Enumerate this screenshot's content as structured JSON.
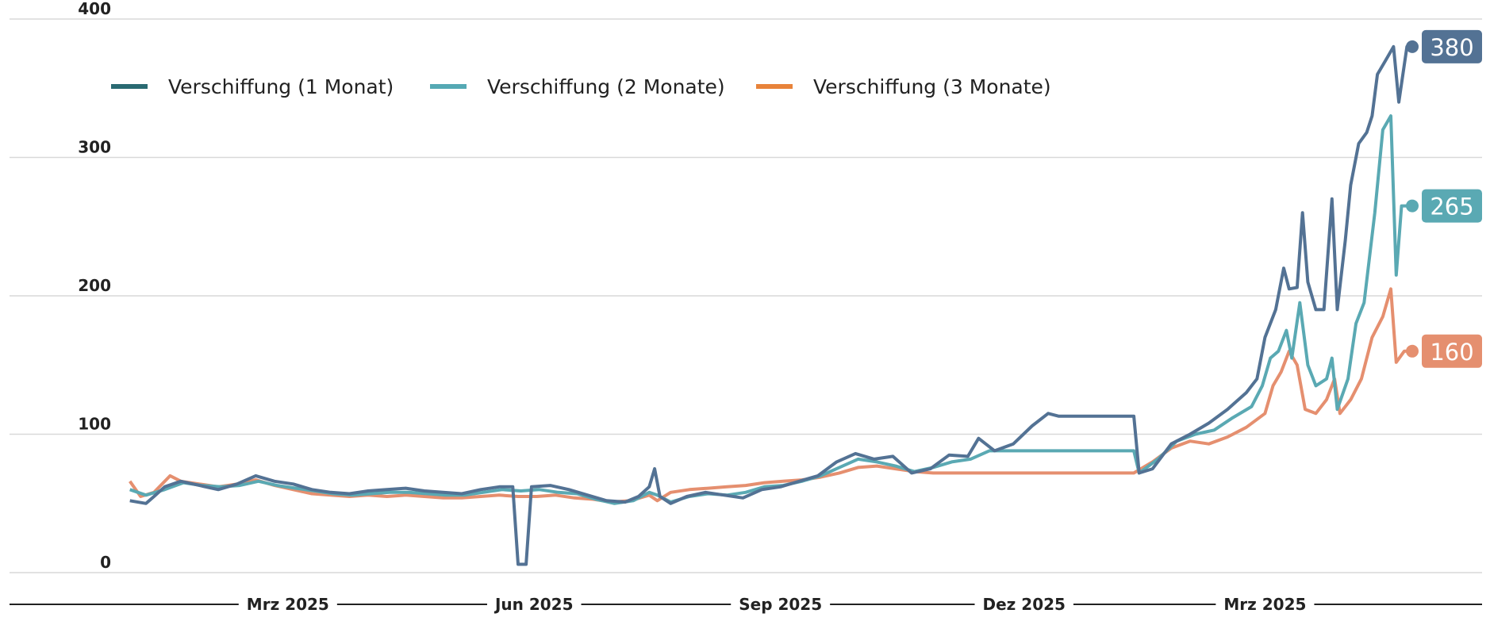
{
  "chart_data": {
    "type": "line",
    "title": "",
    "xlabel": "",
    "ylabel": "",
    "ylim": [
      0,
      400
    ],
    "yticks": [
      0,
      100,
      200,
      300,
      400
    ],
    "xlim": [
      "2024-12-22",
      "2026-04-25"
    ],
    "xticks": [
      {
        "date": "2025-03-01",
        "label": "Mrz 2025"
      },
      {
        "date": "2025-06-01",
        "label": "Jun 2025"
      },
      {
        "date": "2025-09-01",
        "label": "Sep 2025"
      },
      {
        "date": "2025-12-01",
        "label": "Dez 2025"
      },
      {
        "date": "2026-03-01",
        "label": "Mrz 2025"
      }
    ],
    "grid": true,
    "legend_position": "top-left",
    "series": [
      {
        "name": "Verschiffung (1 Monat)",
        "legend_color": "#2a6a72",
        "line_color": "#537294",
        "end_value": "380",
        "points": [
          [
            "2025-01-01",
            52
          ],
          [
            "2025-01-07",
            50
          ],
          [
            "2025-01-10",
            55
          ],
          [
            "2025-01-14",
            62
          ],
          [
            "2025-01-20",
            66
          ],
          [
            "2025-01-27",
            63
          ],
          [
            "2025-02-03",
            60
          ],
          [
            "2025-02-10",
            64
          ],
          [
            "2025-02-17",
            70
          ],
          [
            "2025-02-24",
            66
          ],
          [
            "2025-03-03",
            64
          ],
          [
            "2025-03-10",
            60
          ],
          [
            "2025-03-17",
            58
          ],
          [
            "2025-03-24",
            57
          ],
          [
            "2025-03-31",
            59
          ],
          [
            "2025-04-07",
            60
          ],
          [
            "2025-04-14",
            61
          ],
          [
            "2025-04-21",
            59
          ],
          [
            "2025-04-28",
            58
          ],
          [
            "2025-05-05",
            57
          ],
          [
            "2025-05-12",
            60
          ],
          [
            "2025-05-19",
            62
          ],
          [
            "2025-05-24",
            62
          ],
          [
            "2025-05-26",
            6
          ],
          [
            "2025-05-29",
            6
          ],
          [
            "2025-05-31",
            62
          ],
          [
            "2025-06-07",
            63
          ],
          [
            "2025-06-14",
            60
          ],
          [
            "2025-06-21",
            56
          ],
          [
            "2025-06-28",
            52
          ],
          [
            "2025-07-05",
            51
          ],
          [
            "2025-07-10",
            55
          ],
          [
            "2025-07-14",
            62
          ],
          [
            "2025-07-16",
            75
          ],
          [
            "2025-07-18",
            55
          ],
          [
            "2025-07-22",
            50
          ],
          [
            "2025-07-28",
            55
          ],
          [
            "2025-08-04",
            58
          ],
          [
            "2025-08-11",
            56
          ],
          [
            "2025-08-18",
            54
          ],
          [
            "2025-08-25",
            60
          ],
          [
            "2025-09-01",
            62
          ],
          [
            "2025-09-08",
            66
          ],
          [
            "2025-09-15",
            70
          ],
          [
            "2025-09-22",
            80
          ],
          [
            "2025-09-29",
            86
          ],
          [
            "2025-10-06",
            82
          ],
          [
            "2025-10-13",
            84
          ],
          [
            "2025-10-20",
            72
          ],
          [
            "2025-10-27",
            75
          ],
          [
            "2025-11-03",
            85
          ],
          [
            "2025-11-10",
            84
          ],
          [
            "2025-11-14",
            97
          ],
          [
            "2025-11-20",
            88
          ],
          [
            "2025-11-27",
            93
          ],
          [
            "2025-12-04",
            106
          ],
          [
            "2025-12-10",
            115
          ],
          [
            "2025-12-14",
            113
          ],
          [
            "2026-01-11",
            113
          ],
          [
            "2026-01-13",
            72
          ],
          [
            "2026-01-18",
            75
          ],
          [
            "2026-01-25",
            93
          ],
          [
            "2026-02-01",
            100
          ],
          [
            "2026-02-08",
            108
          ],
          [
            "2026-02-15",
            118
          ],
          [
            "2026-02-22",
            130
          ],
          [
            "2026-02-26",
            140
          ],
          [
            "2026-03-01",
            170
          ],
          [
            "2026-03-05",
            190
          ],
          [
            "2026-03-08",
            220
          ],
          [
            "2026-03-10",
            205
          ],
          [
            "2026-03-13",
            206
          ],
          [
            "2026-03-15",
            260
          ],
          [
            "2026-03-17",
            210
          ],
          [
            "2026-03-20",
            190
          ],
          [
            "2026-03-23",
            190
          ],
          [
            "2026-03-26",
            270
          ],
          [
            "2026-03-28",
            190
          ],
          [
            "2026-03-31",
            240
          ],
          [
            "2026-04-02",
            280
          ],
          [
            "2026-04-05",
            310
          ],
          [
            "2026-04-08",
            318
          ],
          [
            "2026-04-10",
            330
          ],
          [
            "2026-04-12",
            360
          ],
          [
            "2026-04-15",
            370
          ],
          [
            "2026-04-18",
            380
          ],
          [
            "2026-04-20",
            340
          ],
          [
            "2026-04-23",
            380
          ],
          [
            "2026-04-25",
            380
          ]
        ]
      },
      {
        "name": "Verschiffung (2 Monate)",
        "legend_color": "#55a9b4",
        "line_color": "#5aa9b3",
        "end_value": "265",
        "points": [
          [
            "2025-01-01",
            60
          ],
          [
            "2025-01-07",
            56
          ],
          [
            "2025-01-14",
            60
          ],
          [
            "2025-01-21",
            65
          ],
          [
            "2025-01-28",
            63
          ],
          [
            "2025-02-04",
            62
          ],
          [
            "2025-02-11",
            63
          ],
          [
            "2025-02-18",
            66
          ],
          [
            "2025-02-25",
            63
          ],
          [
            "2025-03-04",
            61
          ],
          [
            "2025-03-11",
            59
          ],
          [
            "2025-03-18",
            57
          ],
          [
            "2025-03-25",
            56
          ],
          [
            "2025-04-01",
            57
          ],
          [
            "2025-04-08",
            58
          ],
          [
            "2025-04-15",
            58
          ],
          [
            "2025-04-22",
            57
          ],
          [
            "2025-04-29",
            56
          ],
          [
            "2025-05-06",
            56
          ],
          [
            "2025-05-13",
            58
          ],
          [
            "2025-05-20",
            60
          ],
          [
            "2025-05-27",
            59
          ],
          [
            "2025-06-03",
            60
          ],
          [
            "2025-06-10",
            58
          ],
          [
            "2025-06-17",
            57
          ],
          [
            "2025-06-24",
            53
          ],
          [
            "2025-07-01",
            50
          ],
          [
            "2025-07-08",
            52
          ],
          [
            "2025-07-14",
            58
          ],
          [
            "2025-07-17",
            56
          ],
          [
            "2025-07-22",
            51
          ],
          [
            "2025-07-29",
            55
          ],
          [
            "2025-08-05",
            57
          ],
          [
            "2025-08-12",
            56
          ],
          [
            "2025-08-19",
            58
          ],
          [
            "2025-08-26",
            62
          ],
          [
            "2025-09-02",
            63
          ],
          [
            "2025-09-09",
            66
          ],
          [
            "2025-09-16",
            70
          ],
          [
            "2025-09-23",
            76
          ],
          [
            "2025-09-30",
            82
          ],
          [
            "2025-10-07",
            80
          ],
          [
            "2025-10-14",
            77
          ],
          [
            "2025-10-21",
            73
          ],
          [
            "2025-10-28",
            76
          ],
          [
            "2025-11-04",
            80
          ],
          [
            "2025-11-11",
            82
          ],
          [
            "2025-11-18",
            88
          ],
          [
            "2026-01-11",
            88
          ],
          [
            "2026-01-13",
            72
          ],
          [
            "2026-01-20",
            82
          ],
          [
            "2026-01-27",
            95
          ],
          [
            "2026-02-03",
            100
          ],
          [
            "2026-02-10",
            103
          ],
          [
            "2026-02-17",
            112
          ],
          [
            "2026-02-24",
            120
          ],
          [
            "2026-02-28",
            135
          ],
          [
            "2026-03-03",
            155
          ],
          [
            "2026-03-06",
            160
          ],
          [
            "2026-03-09",
            175
          ],
          [
            "2026-03-11",
            155
          ],
          [
            "2026-03-14",
            195
          ],
          [
            "2026-03-17",
            150
          ],
          [
            "2026-03-20",
            135
          ],
          [
            "2026-03-24",
            140
          ],
          [
            "2026-03-26",
            155
          ],
          [
            "2026-03-28",
            118
          ],
          [
            "2026-04-01",
            140
          ],
          [
            "2026-04-04",
            180
          ],
          [
            "2026-04-07",
            195
          ],
          [
            "2026-04-11",
            260
          ],
          [
            "2026-04-14",
            320
          ],
          [
            "2026-04-17",
            330
          ],
          [
            "2026-04-19",
            215
          ],
          [
            "2026-04-21",
            265
          ],
          [
            "2026-04-25",
            265
          ]
        ]
      },
      {
        "name": "Verschiffung (3 Monate)",
        "legend_color": "#e8833a",
        "line_color": "#e58f6f",
        "end_value": "160",
        "points": [
          [
            "2025-01-01",
            66
          ],
          [
            "2025-01-05",
            55
          ],
          [
            "2025-01-10",
            58
          ],
          [
            "2025-01-16",
            70
          ],
          [
            "2025-01-20",
            66
          ],
          [
            "2025-01-27",
            64
          ],
          [
            "2025-02-03",
            62
          ],
          [
            "2025-02-10",
            64
          ],
          [
            "2025-02-17",
            67
          ],
          [
            "2025-02-24",
            63
          ],
          [
            "2025-03-03",
            60
          ],
          [
            "2025-03-10",
            57
          ],
          [
            "2025-03-17",
            56
          ],
          [
            "2025-03-24",
            55
          ],
          [
            "2025-03-31",
            56
          ],
          [
            "2025-04-07",
            55
          ],
          [
            "2025-04-14",
            56
          ],
          [
            "2025-04-21",
            55
          ],
          [
            "2025-04-28",
            54
          ],
          [
            "2025-05-05",
            54
          ],
          [
            "2025-05-12",
            55
          ],
          [
            "2025-05-19",
            56
          ],
          [
            "2025-05-26",
            55
          ],
          [
            "2025-06-02",
            55
          ],
          [
            "2025-06-09",
            56
          ],
          [
            "2025-06-16",
            54
          ],
          [
            "2025-06-23",
            53
          ],
          [
            "2025-06-30",
            51
          ],
          [
            "2025-07-07",
            52
          ],
          [
            "2025-07-14",
            56
          ],
          [
            "2025-07-17",
            52
          ],
          [
            "2025-07-22",
            58
          ],
          [
            "2025-07-29",
            60
          ],
          [
            "2025-08-05",
            61
          ],
          [
            "2025-08-12",
            62
          ],
          [
            "2025-08-19",
            63
          ],
          [
            "2025-08-26",
            65
          ],
          [
            "2025-09-02",
            66
          ],
          [
            "2025-09-09",
            67
          ],
          [
            "2025-09-16",
            69
          ],
          [
            "2025-09-23",
            72
          ],
          [
            "2025-09-30",
            76
          ],
          [
            "2025-10-07",
            77
          ],
          [
            "2025-10-14",
            75
          ],
          [
            "2025-10-21",
            73
          ],
          [
            "2025-10-28",
            72
          ],
          [
            "2026-01-11",
            72
          ],
          [
            "2026-01-18",
            80
          ],
          [
            "2026-01-25",
            90
          ],
          [
            "2026-02-01",
            95
          ],
          [
            "2026-02-08",
            93
          ],
          [
            "2026-02-15",
            98
          ],
          [
            "2026-02-22",
            105
          ],
          [
            "2026-03-01",
            115
          ],
          [
            "2026-03-04",
            135
          ],
          [
            "2026-03-07",
            145
          ],
          [
            "2026-03-10",
            160
          ],
          [
            "2026-03-13",
            150
          ],
          [
            "2026-03-16",
            118
          ],
          [
            "2026-03-20",
            115
          ],
          [
            "2026-03-24",
            125
          ],
          [
            "2026-03-27",
            140
          ],
          [
            "2026-03-29",
            115
          ],
          [
            "2026-04-02",
            125
          ],
          [
            "2026-04-06",
            140
          ],
          [
            "2026-04-10",
            170
          ],
          [
            "2026-04-14",
            185
          ],
          [
            "2026-04-17",
            205
          ],
          [
            "2026-04-19",
            152
          ],
          [
            "2026-04-22",
            160
          ],
          [
            "2026-04-25",
            160
          ]
        ]
      }
    ]
  }
}
